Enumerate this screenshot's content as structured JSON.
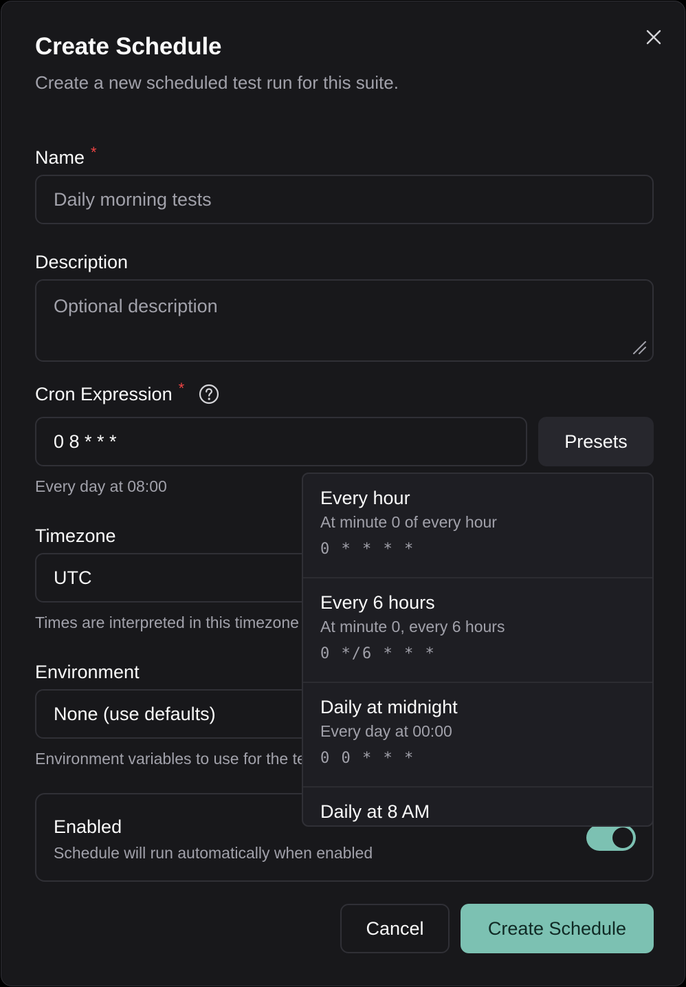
{
  "dialog": {
    "title": "Create Schedule",
    "subtitle": "Create a new scheduled test run for this suite."
  },
  "form": {
    "name": {
      "label": "Name",
      "required": "*",
      "placeholder": "Daily morning tests"
    },
    "description": {
      "label": "Description",
      "placeholder": "Optional description"
    },
    "cron": {
      "label": "Cron Expression",
      "required": "*",
      "value": "0 8 * * *",
      "help": "Every day at 08:00",
      "presets_label": "Presets"
    },
    "timezone": {
      "label": "Timezone",
      "value": "UTC",
      "help": "Times are interpreted in this timezone"
    },
    "environment": {
      "label": "Environment",
      "value": "None (use defaults)",
      "help": "Environment variables to use for the test run"
    },
    "enabled": {
      "title": "Enabled",
      "description": "Schedule will run automatically when enabled",
      "value": true
    }
  },
  "presets": [
    {
      "name": "Every hour",
      "description": "At minute 0 of every hour",
      "cron": "0 * * * *"
    },
    {
      "name": "Every 6 hours",
      "description": "At minute 0, every 6 hours",
      "cron": "0 */6 * * *"
    },
    {
      "name": "Daily at midnight",
      "description": "Every day at 00:00",
      "cron": "0 0 * * *"
    },
    {
      "name": "Daily at 8 AM",
      "description": "",
      "cron": ""
    }
  ],
  "actions": {
    "cancel": "Cancel",
    "submit": "Create Schedule"
  },
  "colors": {
    "accent": "#7cc1b2",
    "required": "#ef4444",
    "background": "#18181b",
    "border": "#303036"
  }
}
